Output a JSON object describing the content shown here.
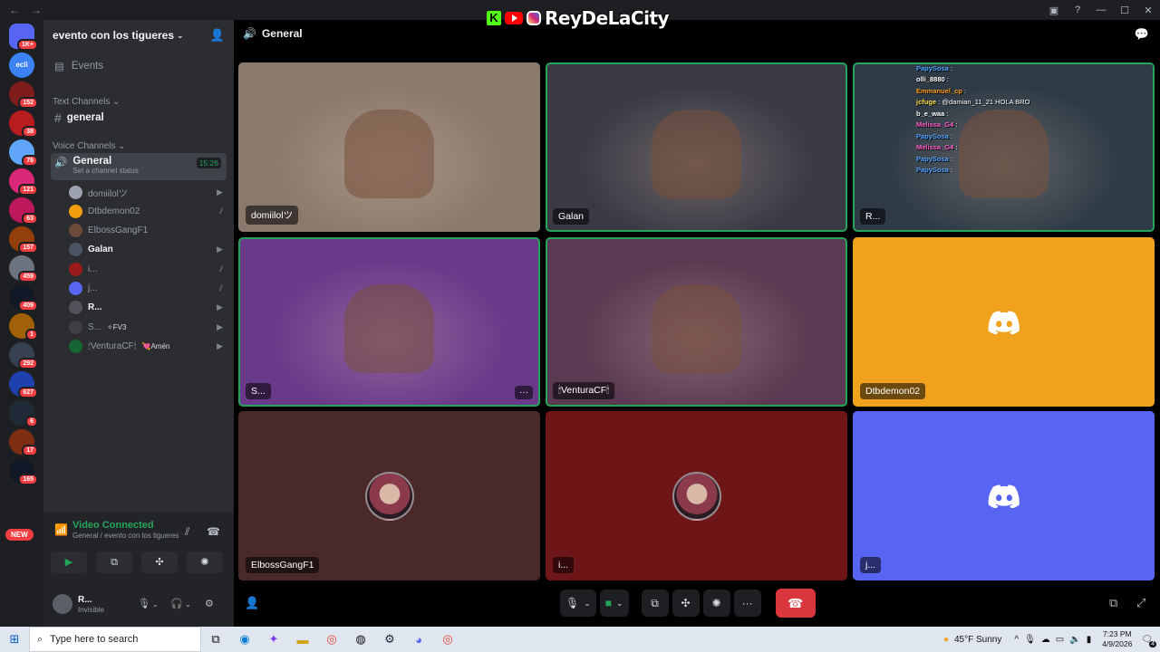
{
  "window": {
    "back_icon": "arrow-left",
    "forward_icon": "arrow-right"
  },
  "overlay": {
    "brand_text": "ReyDeLaCity",
    "icons": [
      "kick-logo",
      "youtube-logo",
      "instagram-logo"
    ]
  },
  "rail": {
    "servers": [
      {
        "badge": "1K+",
        "color": "#5865f2"
      },
      {
        "badge": "",
        "color": "#3b82f6",
        "label": "ecli"
      },
      {
        "badge": "152",
        "color": "#7f1d1d"
      },
      {
        "badge": "38",
        "color": "#b91c1c"
      },
      {
        "badge": "76",
        "color": "#60a5fa"
      },
      {
        "badge": "121",
        "color": "#db2777"
      },
      {
        "badge": "63",
        "color": "#be185d"
      },
      {
        "badge": "157",
        "color": "#92400e"
      },
      {
        "badge": "459",
        "color": "#6b7280"
      },
      {
        "badge": "409",
        "color": "#111827"
      },
      {
        "badge": "1",
        "color": "#a16207"
      },
      {
        "badge": "292",
        "color": "#374151"
      },
      {
        "badge": "627",
        "color": "#1e40af"
      },
      {
        "badge": "6",
        "color": "#1f2937"
      },
      {
        "badge": "17",
        "color": "#7c2d12"
      },
      {
        "badge": "165",
        "color": "#111827"
      }
    ],
    "new_label": "NEW"
  },
  "sidebar": {
    "server_name": "evento con los tigueres",
    "events_label": "Events",
    "text_category": "Text Channels",
    "text_channel": "general",
    "voice_category": "Voice Channels",
    "voice_channel": {
      "name": "General",
      "time": "15:26",
      "status_placeholder": "Set a channel status"
    },
    "members": [
      {
        "name": "domiilolツ",
        "tag": "",
        "color": "#9ca3af",
        "icon": "video-icon"
      },
      {
        "name": "Dtbdemon02",
        "tag": "",
        "color": "#f59e0b",
        "icon": "mic-muted-icon"
      },
      {
        "name": "ElbossGangF1",
        "tag": "",
        "color": "#6b4a3a",
        "icon": ""
      },
      {
        "name": "Galan",
        "tag": "",
        "color": "#4b5563",
        "icon": "video-icon"
      },
      {
        "name": "i...",
        "tag": "",
        "color": "#991b1b",
        "icon": "mic-muted-icon"
      },
      {
        "name": "j...",
        "tag": "",
        "color": "#5865f2",
        "icon": "deafened-icon"
      },
      {
        "name": "R...",
        "tag": "",
        "color": "#52525b",
        "icon": "video-icon"
      },
      {
        "name": "S...",
        "tag": "✧FV3",
        "color": "#3f3f46",
        "icon": "video-icon"
      },
      {
        "name": "🕯VenturaCF🕯",
        "tag": "💘Amén",
        "color": "#166534",
        "icon": "video-icon"
      }
    ]
  },
  "voice_panel": {
    "title": "Video Connected",
    "subtitle": "General / evento con los tigueres"
  },
  "user_panel": {
    "name": "R...",
    "status": "Invisible"
  },
  "channel_header": {
    "title": "General"
  },
  "tiles": [
    {
      "name": "domiilolツ",
      "type": "video",
      "bg": "#8a7a6e",
      "speaking": false
    },
    {
      "name": "Galan",
      "type": "video",
      "bg": "#3a3a44",
      "speaking": true
    },
    {
      "name": "R...",
      "type": "video",
      "bg": "#2e3b46",
      "speaking": true
    },
    {
      "name": "S...",
      "type": "video",
      "bg": "#6a3a8a",
      "speaking": true
    },
    {
      "name": "🕯VenturaCF🕯",
      "type": "video",
      "bg": "#5a3a52",
      "speaking": true
    },
    {
      "name": "Dtbdemon02",
      "type": "discord",
      "bg": "#f0a21f",
      "speaking": false
    },
    {
      "name": "ElbossGangF1",
      "type": "avatar",
      "bg": "#4a2a29",
      "speaking": false
    },
    {
      "name": "i...",
      "type": "avatar",
      "bg": "#6e1517",
      "speaking": false
    },
    {
      "name": "j...",
      "type": "discord",
      "bg": "#5865f2",
      "speaking": false
    }
  ],
  "chat_overlay": [
    {
      "user": "PapySosa",
      "color": "#4fa3ff",
      "msg": ""
    },
    {
      "user": "PapySosa",
      "color": "#4fa3ff",
      "msg": ""
    },
    {
      "user": "olli_8880",
      "color": "#ffffff",
      "msg": ""
    },
    {
      "user": "Emmanuel_cp",
      "color": "#ff9f1a",
      "msg": ""
    },
    {
      "user": "jcfuge",
      "color": "#ffe14a",
      "msg": "@damian_11_21 HOLA BRO"
    },
    {
      "user": "b_e_waa",
      "color": "#ffffff",
      "msg": ""
    },
    {
      "user": "Melissa_G4",
      "color": "#ff5ecf",
      "msg": ""
    },
    {
      "user": "PapySosa",
      "color": "#4fa3ff",
      "msg": ""
    },
    {
      "user": "Melissa_G4",
      "color": "#ff5ecf",
      "msg": ""
    },
    {
      "user": "PapySosa",
      "color": "#4fa3ff",
      "msg": ""
    },
    {
      "user": "PapySosa",
      "color": "#4fa3ff",
      "msg": ""
    }
  ],
  "taskbar": {
    "search_placeholder": "Type here to search",
    "weather": "45°F  Sunny",
    "time": "7:23 PM",
    "date": "4/9/2026",
    "notification_count": "4"
  },
  "colors": {
    "accent_green": "#23a55a",
    "danger": "#da373c",
    "blurple": "#5865f2"
  }
}
